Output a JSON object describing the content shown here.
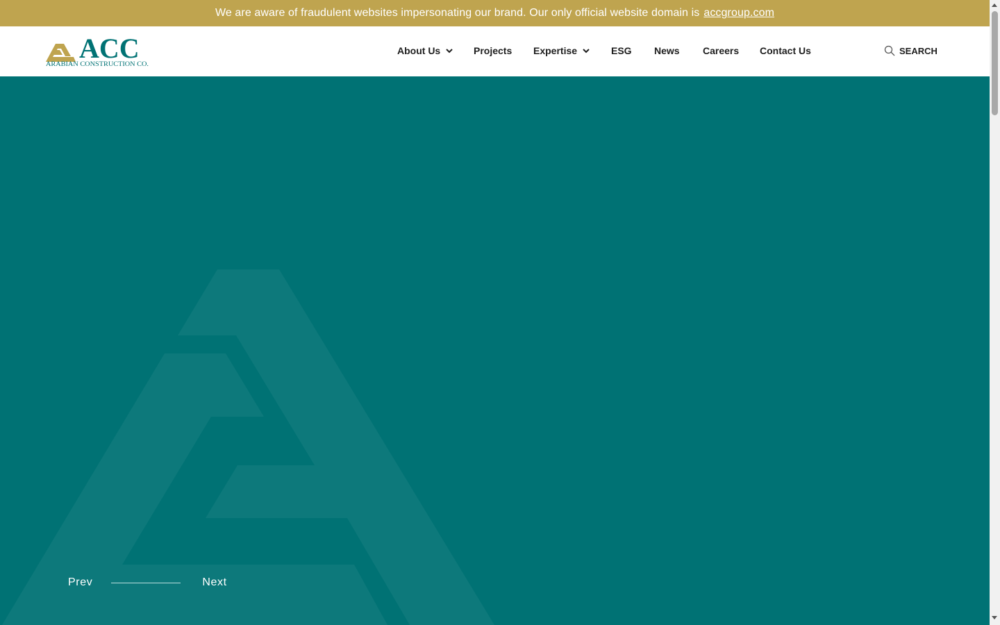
{
  "notice": {
    "text": "We are aware of fraudulent websites impersonating our brand. Our only official website domain is",
    "link": "accgroup.com"
  },
  "logo": {
    "brand": "ACC",
    "tagline": "ARABIAN CONSTRUCTION CO."
  },
  "nav": {
    "items": [
      {
        "label": "About Us",
        "has_dropdown": true
      },
      {
        "label": "Projects",
        "has_dropdown": false
      },
      {
        "label": "Expertise",
        "has_dropdown": true
      },
      {
        "label": "ESG",
        "has_dropdown": false
      },
      {
        "label": "News",
        "has_dropdown": false
      },
      {
        "label": "Careers",
        "has_dropdown": false
      },
      {
        "label": "Contact Us",
        "has_dropdown": false
      }
    ],
    "search_label": "SEARCH"
  },
  "slider": {
    "prev_label": "Prev",
    "next_label": "Next"
  },
  "colors": {
    "notice_bg": "#bfa44f",
    "hero_bg": "#007274",
    "brand_teal": "#007274",
    "brand_gold": "#bfa44f"
  },
  "icons": [
    "search-icon",
    "chevron-down-icon"
  ]
}
